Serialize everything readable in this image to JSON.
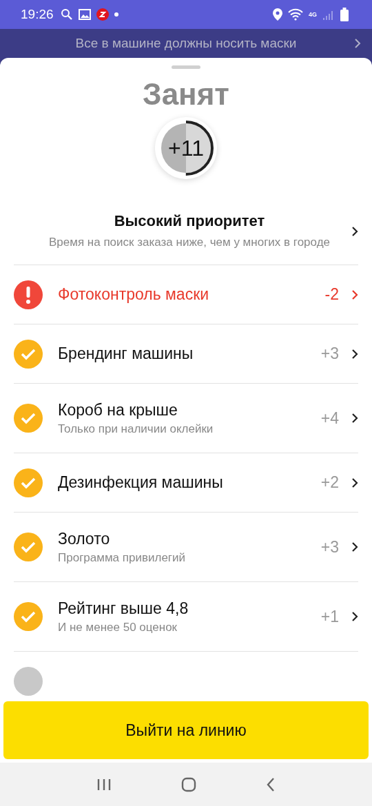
{
  "status_bar": {
    "time": "19:26",
    "network": "4G"
  },
  "banner": {
    "text": "Все в машине должны носить маски"
  },
  "status": {
    "title": "Занят",
    "score": "+11",
    "level": 0.5
  },
  "priority": {
    "title": "Высокий приоритет",
    "subtitle": "Время на поиск заказа ниже, чем у многих в городе"
  },
  "items": [
    {
      "kind": "error",
      "title": "Фотоконтроль маски",
      "value": "-2"
    },
    {
      "kind": "ok",
      "title": "Брендинг машины",
      "value": "+3"
    },
    {
      "kind": "ok",
      "title": "Короб на крыше",
      "subtitle": "Только при наличии оклейки",
      "value": "+4"
    },
    {
      "kind": "ok",
      "title": "Дезинфекция машины",
      "value": "+2"
    },
    {
      "kind": "ok",
      "title": "Золото",
      "subtitle": "Программа привилегий",
      "value": "+3"
    },
    {
      "kind": "ok",
      "title": "Рейтинг выше 4,8",
      "subtitle": "И не менее 50 оценок",
      "value": "+1"
    },
    {
      "kind": "pending"
    }
  ],
  "button": {
    "label": "Выйти на линию"
  }
}
